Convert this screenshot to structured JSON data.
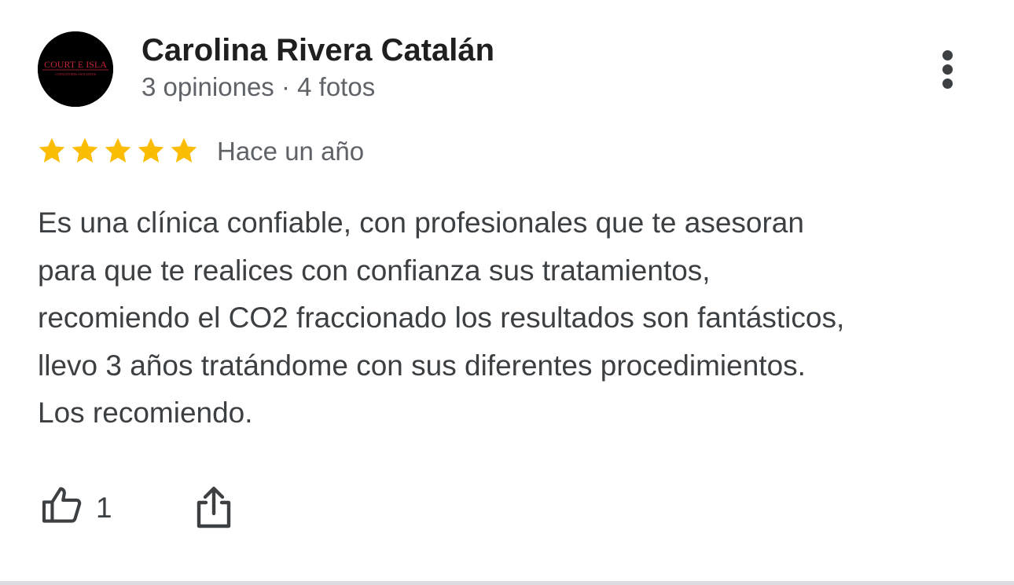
{
  "review": {
    "author": {
      "name": "Carolina Rivera Catalán",
      "meta": "3 opiniones · 4 fotos",
      "avatar_logo": "COURT E ISLA",
      "avatar_tagline": "CONSULTORES ASOCIADOS",
      "avatar_bg": "#000000",
      "avatar_logo_color": "#c0243a"
    },
    "menu_icon": "more-vert-icon",
    "rating": {
      "stars": 5,
      "max": 5,
      "star_color": "#fbbc04",
      "date": "Hace un año"
    },
    "text_lines": [
      "Es una clínica confiable, con profesionales que te asesoran",
      "para que te realices con confianza sus tratamientos,",
      "recomiendo el CO2 fraccionado los resultados son fantásticos,",
      "llevo 3 años tratándome con sus diferentes procedimientos.",
      "Los recomiendo."
    ],
    "actions": {
      "like_icon": "thumb-up-icon",
      "like_count": "1",
      "share_icon": "share-icon"
    }
  }
}
